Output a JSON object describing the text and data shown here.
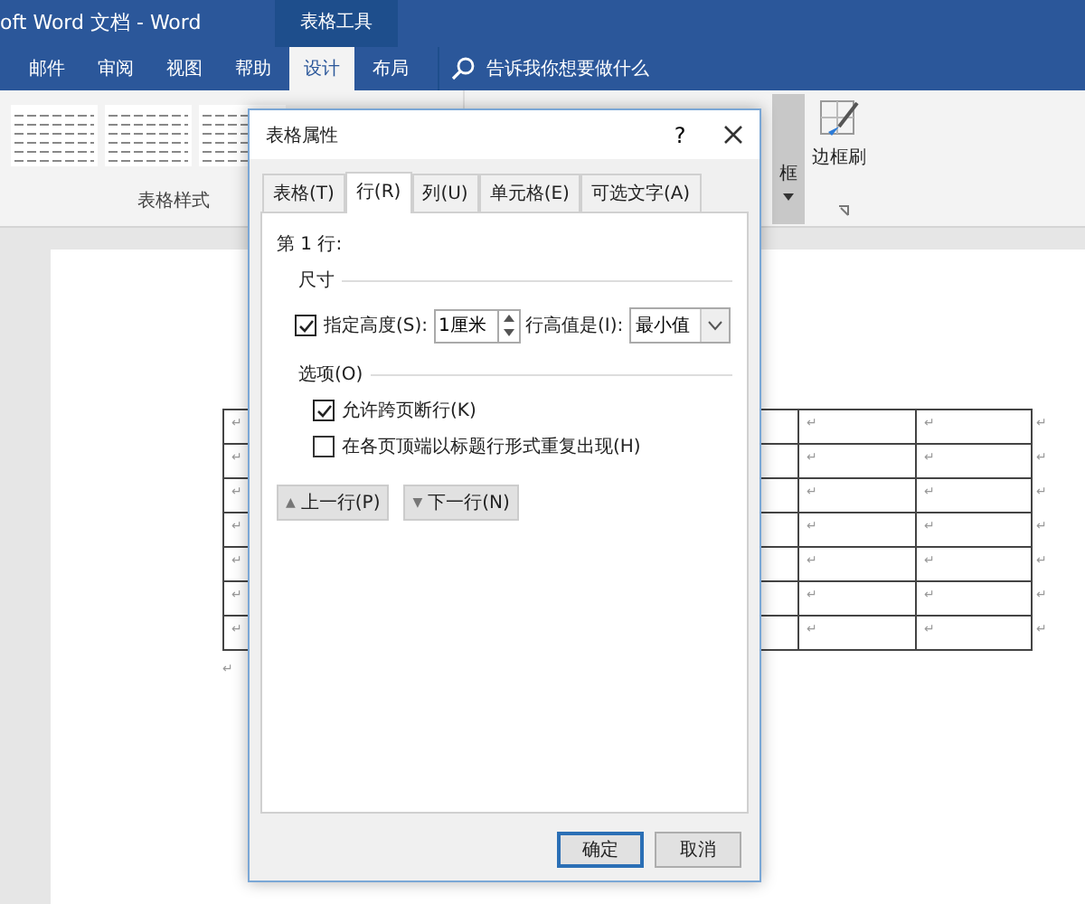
{
  "window": {
    "title": "oft Word 文档  -  Word",
    "context_tab": "表格工具"
  },
  "ribbon_tabs": [
    {
      "label": "邮件",
      "selected": false
    },
    {
      "label": "审阅",
      "selected": false
    },
    {
      "label": "视图",
      "selected": false
    },
    {
      "label": "帮助",
      "selected": false
    },
    {
      "label": "设计",
      "selected": true
    },
    {
      "label": "布局",
      "selected": false
    }
  ],
  "search": {
    "placeholder": "告诉我你想要做什么"
  },
  "ribbon": {
    "group_label": "表格样式",
    "border_button": "框",
    "border_painter": "边框刷"
  },
  "document": {
    "rows": [
      {
        "cells": [
          "↵",
          "↵",
          "↵"
        ],
        "row_end": "↵"
      },
      {
        "cells": [
          "↵",
          "↵",
          "↵"
        ],
        "row_end": "↵"
      },
      {
        "cells": [
          "↵",
          "↵",
          "↵"
        ],
        "row_end": "↵"
      },
      {
        "cells": [
          "↵",
          "↵",
          "↵"
        ],
        "row_end": "↵"
      },
      {
        "cells": [
          "↵",
          "↵",
          "↵"
        ],
        "row_end": "↵"
      },
      {
        "cells": [
          "↵",
          "↵",
          "↵"
        ],
        "row_end": "↵"
      },
      {
        "cells": [
          "↵",
          "↵",
          "↵"
        ],
        "row_end": "↵"
      }
    ],
    "after_table": "↵"
  },
  "dialog": {
    "title": "表格属性",
    "help": "?",
    "tabs": [
      {
        "label": "表格(T)",
        "selected": false
      },
      {
        "label": "行(R)",
        "selected": true
      },
      {
        "label": "列(U)",
        "selected": false
      },
      {
        "label": "单元格(E)",
        "selected": false
      },
      {
        "label": "可选文字(A)",
        "selected": false
      }
    ],
    "row_label": "第 1 行:",
    "size_section": "尺寸",
    "height": {
      "label": "指定高度(S):",
      "checked": true,
      "value": "1厘米"
    },
    "row_height_label": "行高值是(I):",
    "row_height_select": "最小值",
    "options_section": "选项(O)",
    "options": [
      {
        "label": "允许跨页断行(K)",
        "checked": true
      },
      {
        "label": "在各页顶端以标题行形式重复出现(H)",
        "checked": false
      }
    ],
    "nav_buttons": [
      {
        "label": "上一行(P)",
        "icon": "▲"
      },
      {
        "label": "下一行(N)",
        "icon": "▼"
      }
    ],
    "footer_buttons": [
      {
        "label": "确定",
        "default": true
      },
      {
        "label": "取消",
        "default": false
      }
    ]
  }
}
